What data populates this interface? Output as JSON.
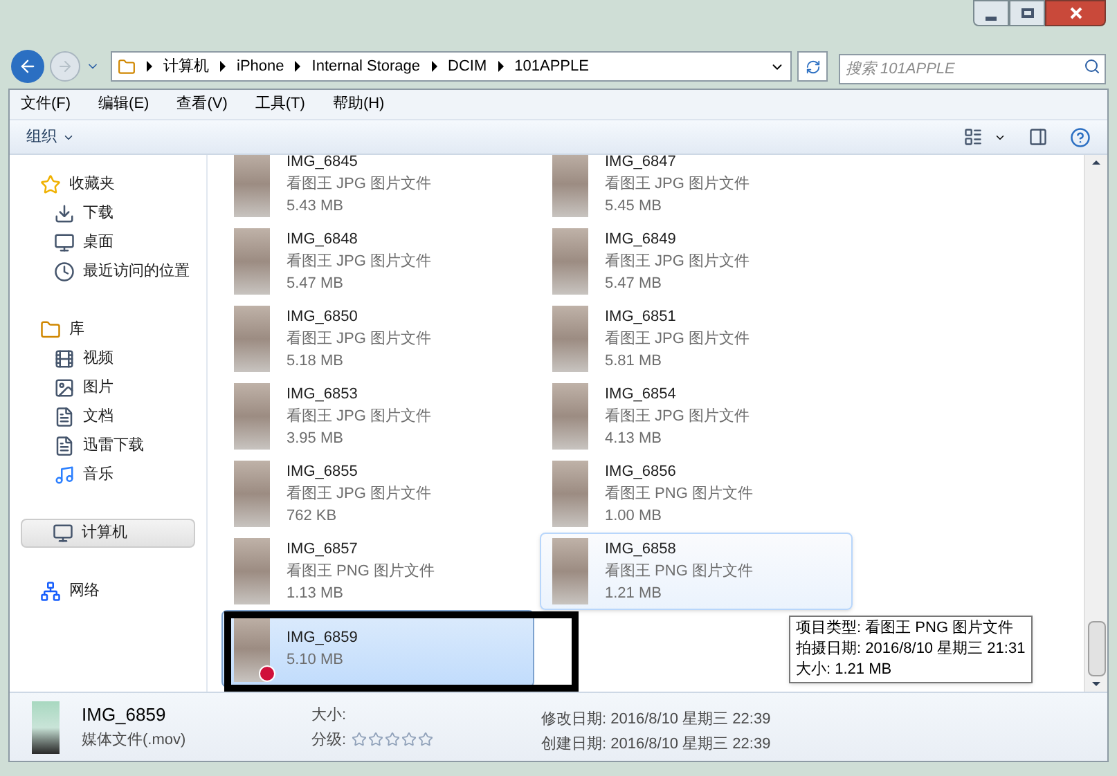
{
  "address": {
    "segments": [
      "计算机",
      "iPhone",
      "Internal Storage",
      "DCIM",
      "101APPLE"
    ]
  },
  "search": {
    "placeholder": "搜索 101APPLE"
  },
  "menu": [
    "文件(F)",
    "编辑(E)",
    "查看(V)",
    "工具(T)",
    "帮助(H)"
  ],
  "toolbar": {
    "organize": "组织"
  },
  "sidebar": [
    {
      "label": "收藏夹",
      "kind": "star",
      "children": [
        {
          "label": "下载",
          "kind": "download",
          "selected": false
        },
        {
          "label": "桌面",
          "kind": "desktop",
          "selected": false
        },
        {
          "label": "最近访问的位置",
          "kind": "recent",
          "selected": false
        }
      ]
    },
    {
      "label": "库",
      "kind": "library",
      "children": [
        {
          "label": "视频",
          "kind": "video",
          "selected": false
        },
        {
          "label": "图片",
          "kind": "picture",
          "selected": false
        },
        {
          "label": "文档",
          "kind": "document",
          "selected": false
        },
        {
          "label": "迅雷下载",
          "kind": "document",
          "selected": false
        },
        {
          "label": "音乐",
          "kind": "music",
          "selected": false
        }
      ]
    },
    {
      "label": "计算机",
      "kind": "computer",
      "selected": true
    },
    {
      "label": "网络",
      "kind": "network"
    }
  ],
  "files": [
    {
      "name": "IMG_6845",
      "type": "看图王 JPG 图片文件",
      "size": "5.43 MB",
      "selected": false,
      "hovered": false
    },
    {
      "name": "IMG_6847",
      "type": "看图王 JPG 图片文件",
      "size": "5.45 MB",
      "selected": false,
      "hovered": false
    },
    {
      "name": "IMG_6848",
      "type": "看图王 JPG 图片文件",
      "size": "5.47 MB",
      "selected": false,
      "hovered": false
    },
    {
      "name": "IMG_6849",
      "type": "看图王 JPG 图片文件",
      "size": "5.47 MB",
      "selected": false,
      "hovered": false
    },
    {
      "name": "IMG_6850",
      "type": "看图王 JPG 图片文件",
      "size": "5.18 MB",
      "selected": false,
      "hovered": false
    },
    {
      "name": "IMG_6851",
      "type": "看图王 JPG 图片文件",
      "size": "5.81 MB",
      "selected": false,
      "hovered": false
    },
    {
      "name": "IMG_6853",
      "type": "看图王 JPG 图片文件",
      "size": "3.95 MB",
      "selected": false,
      "hovered": false
    },
    {
      "name": "IMG_6854",
      "type": "看图王 JPG 图片文件",
      "size": "4.13 MB",
      "selected": false,
      "hovered": false
    },
    {
      "name": "IMG_6855",
      "type": "看图王 JPG 图片文件",
      "size": "762 KB",
      "selected": false,
      "hovered": false
    },
    {
      "name": "IMG_6856",
      "type": "看图王 PNG 图片文件",
      "size": "1.00 MB",
      "selected": false,
      "hovered": false
    },
    {
      "name": "IMG_6857",
      "type": "看图王 PNG 图片文件",
      "size": "1.13 MB",
      "selected": false,
      "hovered": false
    },
    {
      "name": "IMG_6858",
      "type": "看图王 PNG 图片文件",
      "size": "1.21 MB",
      "selected": false,
      "hovered": true
    },
    {
      "name": "IMG_6859",
      "size": "5.10 MB",
      "selected": true,
      "hovered": false
    }
  ],
  "tooltip": [
    "项目类型: 看图王 PNG 图片文件",
    "拍摄日期: 2016/8/10 星期三 21:31",
    "大小: 1.21 MB"
  ],
  "details": {
    "name": "IMG_6859",
    "type": "媒体文件(.mov)",
    "size_label": "大小:",
    "rating_label": "分级:",
    "stars": 0,
    "modified": "修改日期: 2016/8/10 星期三 22:39",
    "created": "创建日期: 2016/8/10 星期三 22:39"
  }
}
